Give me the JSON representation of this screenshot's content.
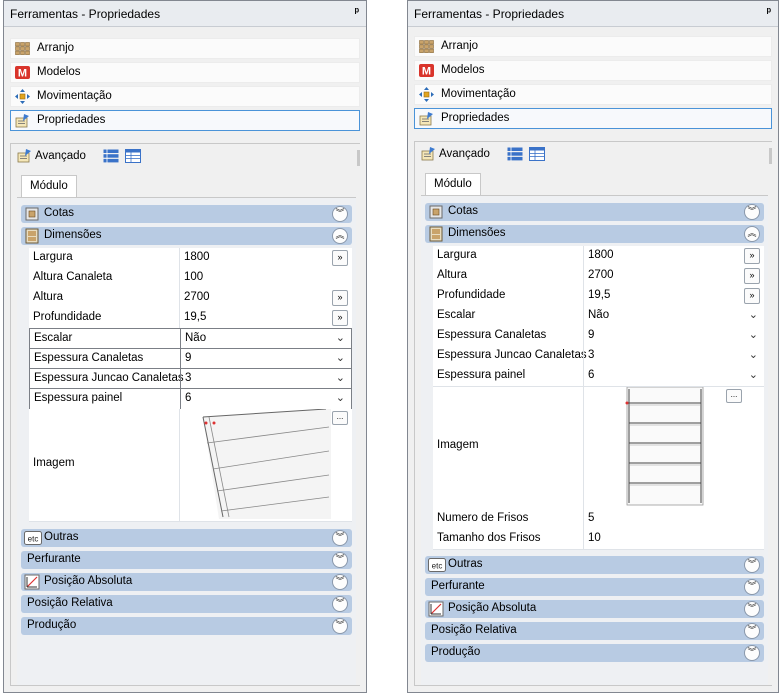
{
  "panel_left": {
    "title": "Ferramentas - Propriedades",
    "pin": "ᵖ",
    "nav": [
      "Arranjo",
      "Modelos",
      "Movimentação",
      "Propriedades"
    ],
    "toolbar_label": "Avançado",
    "tab": "Módulo",
    "sections_top": [
      "Cotas",
      "Dimensões"
    ],
    "rows": [
      {
        "key": "Largura",
        "value": "1800",
        "control": "button"
      },
      {
        "key": "Altura Canaleta",
        "value": "100",
        "control": "none"
      },
      {
        "key": "Altura",
        "value": "2700",
        "control": "button"
      },
      {
        "key": "Profundidade",
        "value": "19,5",
        "control": "button"
      },
      {
        "key": "Escalar",
        "value": "Não",
        "control": "dropdown"
      },
      {
        "key": "Espessura Canaletas",
        "value": "9",
        "control": "dropdown"
      },
      {
        "key": "Espessura Juncao Canaletas",
        "value": "3",
        "control": "dropdown"
      },
      {
        "key": "Espessura painel",
        "value": "6",
        "control": "dropdown"
      }
    ],
    "image_label": "Imagem",
    "ellipsis": "...",
    "sections_bottom": [
      "Outras",
      "Perfurante",
      "Posição Absoluta",
      "Posição Relativa",
      "Produção"
    ],
    "etc_badge": "etc"
  },
  "panel_right": {
    "title": "Ferramentas - Propriedades",
    "pin": "ᵖ",
    "nav": [
      "Arranjo",
      "Modelos",
      "Movimentação",
      "Propriedades"
    ],
    "toolbar_label": "Avançado",
    "tab": "Módulo",
    "sections_top": [
      "Cotas",
      "Dimensões"
    ],
    "rows": [
      {
        "key": "Largura",
        "value": "1800",
        "control": "button"
      },
      {
        "key": "Altura",
        "value": "2700",
        "control": "button"
      },
      {
        "key": "Profundidade",
        "value": "19,5",
        "control": "button"
      },
      {
        "key": "Escalar",
        "value": "Não",
        "control": "dropdown"
      },
      {
        "key": "Espessura Canaletas",
        "value": "9",
        "control": "dropdown"
      },
      {
        "key": "Espessura Juncao Canaletas",
        "value": "3",
        "control": "dropdown"
      },
      {
        "key": "Espessura painel",
        "value": "6",
        "control": "dropdown"
      }
    ],
    "image_label": "Imagem",
    "ellipsis": "...",
    "rows_after": [
      {
        "key": "Numero de Frisos",
        "value": "5"
      },
      {
        "key": "Tamanho dos Frisos",
        "value": "10"
      }
    ],
    "sections_bottom": [
      "Outras",
      "Perfurante",
      "Posição Absoluta",
      "Posição Relativa",
      "Produção"
    ],
    "etc_badge": "etc"
  },
  "colors": {
    "section_header": "#b8cbe3",
    "active_border": "#4a93d8",
    "panel_bg": "#f0f0f0"
  },
  "icons": {
    "pin": "pin-icon",
    "arranjo": "grid-blocks-icon",
    "modelos": "m-logo-icon",
    "movimentacao": "move-arrows-icon",
    "propriedades": "properties-icon",
    "expand": "chevron-double-down-icon",
    "collapse": "chevron-double-up-icon",
    "button": "double-arrow-right-icon",
    "dropdown": "chevron-down-icon"
  }
}
